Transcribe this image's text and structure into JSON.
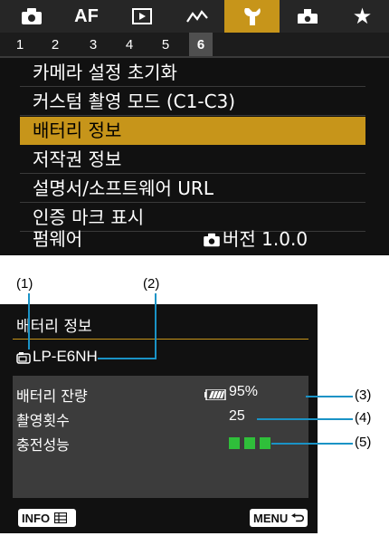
{
  "menu": {
    "tabs": [
      {
        "icon": "camera-icon",
        "active": false
      },
      {
        "label": "AF",
        "active": false
      },
      {
        "icon": "playback-icon",
        "active": false
      },
      {
        "icon": "wave-icon",
        "active": false
      },
      {
        "icon": "wrench-icon",
        "active": true
      },
      {
        "icon": "custom-function-icon",
        "active": false
      },
      {
        "icon": "star-icon",
        "active": false
      }
    ],
    "subtabs": [
      "1",
      "2",
      "3",
      "4",
      "5",
      "6"
    ],
    "active_subtab": "6",
    "items": [
      {
        "label": "카메라 설정 초기화"
      },
      {
        "label": "커스텀 촬영 모드 (C1-C3)"
      },
      {
        "label": "배터리 정보",
        "selected": true
      },
      {
        "label": "저작권 정보"
      },
      {
        "label": "설명서/소프트웨어 URL"
      },
      {
        "label": "인증 마크 표시"
      },
      {
        "label": "펌웨어",
        "value": "버전 1.0.0",
        "value_icon": "camera-icon"
      }
    ]
  },
  "callouts": [
    "(1)",
    "(2)",
    "(3)",
    "(4)",
    "(5)"
  ],
  "battery_info": {
    "title": "배터리 정보",
    "model": "LP-E6NH",
    "model_icon": "camera-body-icon",
    "rows": [
      {
        "label": "배터리 잔량",
        "value": "95%",
        "icon": "battery-level-icon"
      },
      {
        "label": "촬영횟수",
        "value": "25"
      },
      {
        "label": "충전성능",
        "bars_filled": 3,
        "bars_total": 3
      }
    ],
    "buttons": [
      {
        "label": "INFO",
        "icon": "info-grid-icon"
      },
      {
        "label": "MENU",
        "icon": "return-icon"
      }
    ]
  },
  "colors": {
    "accent": "#c7951a",
    "callout_line": "#1a93c6",
    "performance_green": "#2fbf3a",
    "background": "#111111",
    "panel": "#3c3c3c"
  }
}
